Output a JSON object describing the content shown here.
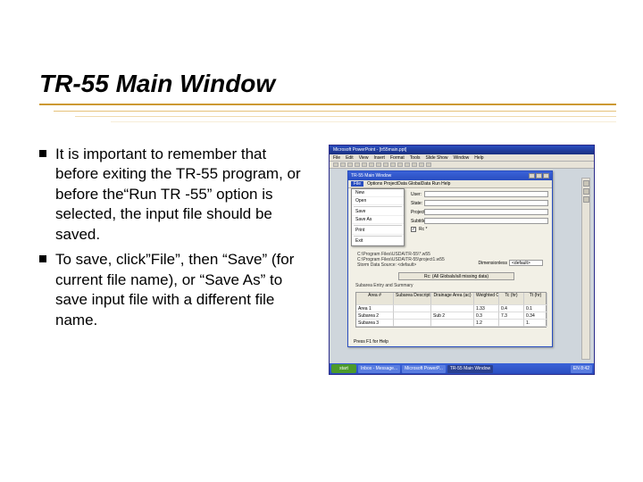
{
  "title": "TR-55 Main Window",
  "bullets": [
    "It is important to remember that before exiting the TR-55 program, or before the“Run TR -55” option is selected, the input file should be saved.",
    "To save, click”File”,  then “Save” (for current file name), or “Save As” to save input file with a different file name."
  ],
  "powerpoint": {
    "titlebar": "Microsoft PowerPoint - [tr55main.ppt]",
    "menu": [
      "File",
      "Edit",
      "View",
      "Insert",
      "Format",
      "Tools",
      "Slide Show",
      "Window",
      "Help"
    ]
  },
  "tr55": {
    "titlebar": "TR-55 Main Window",
    "menu_open": "File",
    "menu_rest": "Options   ProjectData   GlobalData   Run   Help",
    "file_menu": [
      "New",
      "Open",
      "Save",
      "Save As",
      "Print",
      "Exit"
    ],
    "form": {
      "user_label": "User:",
      "user_value": "",
      "state_label": "State:",
      "state_value": "",
      "project_label": "Project:",
      "project_value": "",
      "subtitle_label": "Subtitle:",
      "subtitle_value": "",
      "checkbox_label": "Rc *"
    },
    "paths": [
      "C:\\Program Files\\USDA\\TR-55\\*.w55",
      "C:\\Program Files\\USDA\\TR-55\\project1.w55",
      "Storm Data Source: <default>"
    ],
    "dimensionless": {
      "label": "Dimensionless",
      "value": "<default>"
    },
    "long_button": "Rc: (All Globals/all missing data)",
    "section_label": "Subarea Entry and Summary",
    "table": {
      "headers": [
        "Area #",
        "Subarea Description",
        "Drainage Area (ac)",
        "Weighted CN",
        "Tc (hr)",
        "Tt (hr)"
      ],
      "rows": [
        [
          "Area 1",
          "",
          "",
          "1.33",
          "0.4",
          "0.1"
        ],
        [
          "Subarea 2",
          "",
          "Sub 2",
          "0.3",
          "7.3",
          "0.34"
        ],
        [
          "Subarea 3",
          "",
          "",
          "1.2",
          "",
          "1."
        ]
      ]
    },
    "footer": "Press F1 for Help"
  },
  "taskbar": {
    "start": "start",
    "buttons": [
      "Inbox - Message...",
      "Microsoft PowerP...",
      "TR-55 Main Window"
    ],
    "tray": "EN   8:42"
  }
}
